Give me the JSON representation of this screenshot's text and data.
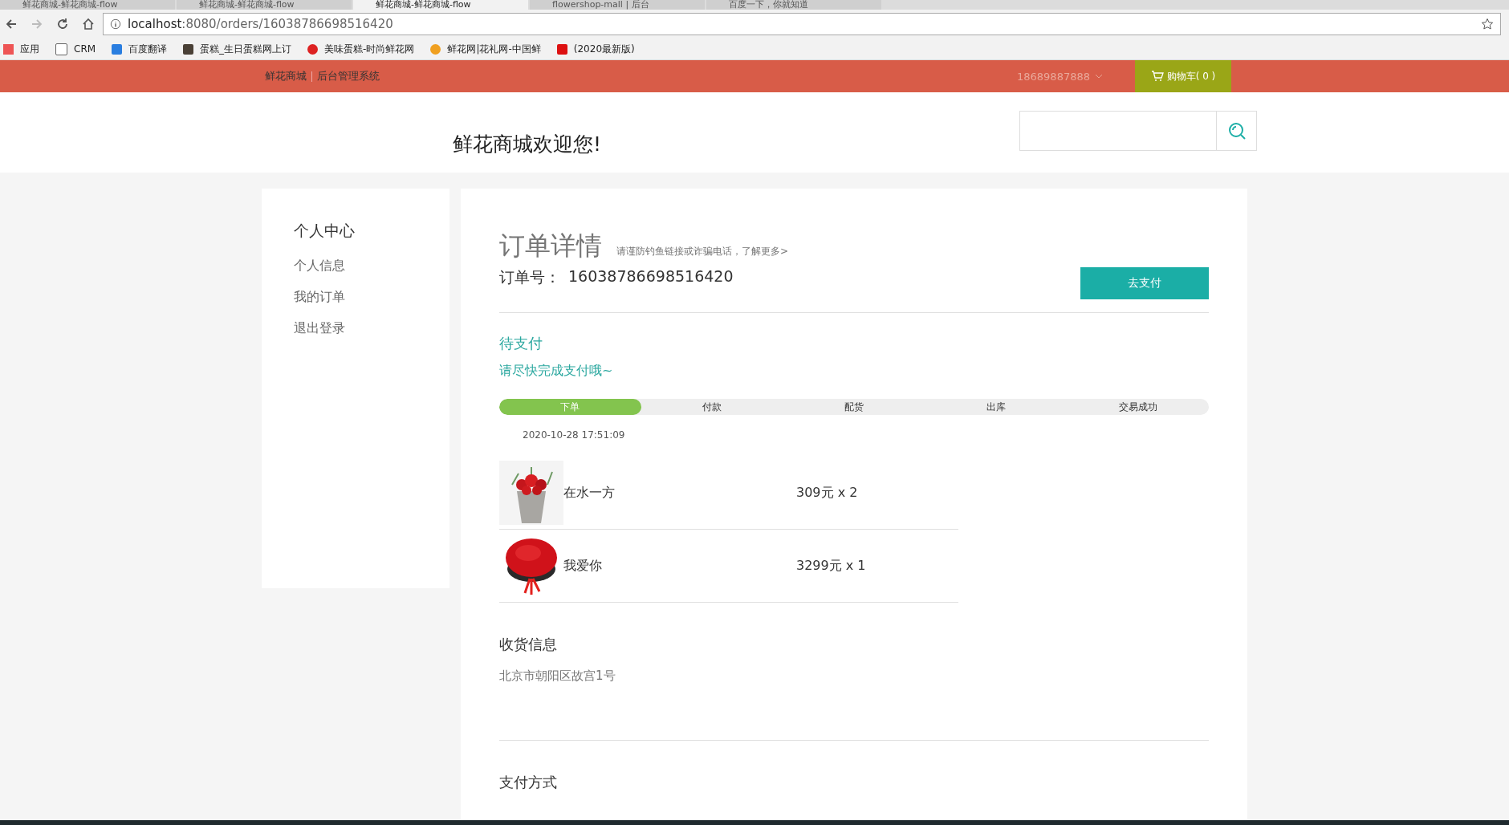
{
  "browser": {
    "tabs": [
      {
        "title": "鲜花商城-鲜花商城-flow",
        "selected": false
      },
      {
        "title": "鲜花商城-鲜花商城-flow",
        "selected": false
      },
      {
        "title": "鲜花商城-鲜花商城-flow",
        "selected": true
      },
      {
        "title": "flowershop-mall | 后台",
        "selected": false
      },
      {
        "title": "百度一下，你就知道",
        "selected": false
      }
    ],
    "url_host": "localhost",
    "url_rest": ":8080/orders/16038786698516420",
    "bookmarks": [
      "应用",
      "CRM",
      "百度翻译",
      "蛋糕_生日蛋糕网上订",
      "美味蛋糕-时尚鲜花网",
      "鲜花网|花礼网-中国鲜",
      "(2020最新版)"
    ]
  },
  "topbar": {
    "links": [
      "鲜花商城",
      "后台管理系统"
    ],
    "user": "18689887888",
    "cart": "购物车( 0 )"
  },
  "header": {
    "welcome": "鲜花商城欢迎您!"
  },
  "sidebar": {
    "title": "个人中心",
    "items": [
      "个人信息",
      "我的订单",
      "退出登录"
    ]
  },
  "order": {
    "title": "订单详情",
    "notice": "请谨防钓鱼链接或诈骗电话，了解更多>",
    "number_label": "订单号：",
    "number": "16038786698516420",
    "pay_button": "去支付",
    "status": "待支付",
    "status_hint": "请尽快完成支付哦~",
    "steps": [
      {
        "label": "下单",
        "done": true
      },
      {
        "label": "付款",
        "done": false
      },
      {
        "label": "配货",
        "done": false
      },
      {
        "label": "出库",
        "done": false
      },
      {
        "label": "交易成功",
        "done": false
      }
    ],
    "time": "2020-10-28 17:51:09",
    "items": [
      {
        "name": "在水一方",
        "price": "309元 x 2",
        "kind": "picture"
      },
      {
        "name": "我爱你",
        "price": "3299元 x 1",
        "kind": "picture"
      }
    ],
    "address_title": "收货信息",
    "address": "北京市朝阳区故宫1号",
    "payment_title": "支付方式"
  }
}
